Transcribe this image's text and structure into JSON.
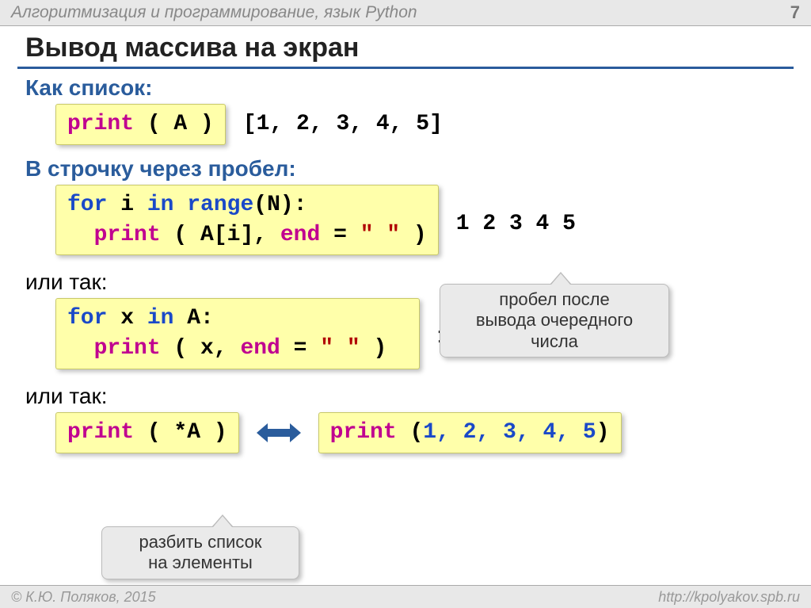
{
  "header": {
    "topic": "Алгоритмизация и программирование, язык Python",
    "page": "7"
  },
  "title": "Вывод массива на экран",
  "sec1": {
    "label": "Как список:",
    "code": {
      "print": "print",
      "open": " ( A )"
    },
    "out": "[1, 2, 3, 4, 5]"
  },
  "sec2": {
    "label": "В строчку через пробел:",
    "code": {
      "for": "for",
      "var": " i ",
      "in": "in",
      "range": " range",
      "rest": "(N):",
      "print": "print",
      "args1": " ( A[i], ",
      "end": "end",
      "eq": " = ",
      "s": "\" \"",
      "close": " )"
    },
    "out": "1 2 3 4 5",
    "note": "пробел после\nвывода очередного\nчисла"
  },
  "sec3": {
    "label": "или так:",
    "code": {
      "for": "for",
      "var": " x ",
      "in": "in",
      "A": " A:",
      "print": "print",
      "args1": " ( x, ",
      "end": "end",
      "eq": " = ",
      "s": "\" \"",
      "close": " )"
    },
    "out": "1 2 3 4 5"
  },
  "sec4": {
    "label": "или так:",
    "left": {
      "print": "print",
      "rest": " ( *A )"
    },
    "right": {
      "print": "print",
      "open": " (",
      "nums": "1, 2, 3, 4, 5",
      "close": ")"
    },
    "note": "разбить список\nна элементы"
  },
  "footer": {
    "left": "© К.Ю. Поляков, 2015",
    "right": "http://kpolyakov.spb.ru"
  }
}
